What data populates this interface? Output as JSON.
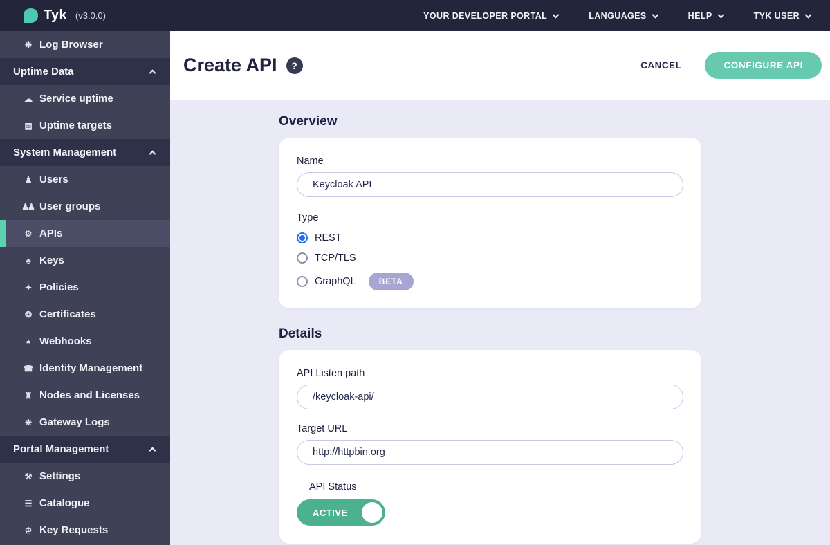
{
  "navbar": {
    "brand": "Tyk",
    "version": "(v3.0.0)",
    "menus": [
      {
        "label": "YOUR DEVELOPER PORTAL"
      },
      {
        "label": "LANGUAGES"
      },
      {
        "label": "HELP"
      },
      {
        "label": "TYK USER"
      }
    ]
  },
  "sidebar": {
    "items": [
      {
        "type": "item",
        "label": "Log Browser",
        "icon": "bug-icon",
        "glyph": "❉"
      },
      {
        "type": "section",
        "label": "Uptime Data",
        "icon": "chevron-up-icon"
      },
      {
        "type": "item",
        "label": "Service uptime",
        "icon": "cloud-icon",
        "glyph": "☁"
      },
      {
        "type": "item",
        "label": "Uptime targets",
        "icon": "grid-list-icon",
        "glyph": "▤"
      },
      {
        "type": "section",
        "label": "System Management",
        "icon": "chevron-up-icon"
      },
      {
        "type": "item",
        "label": "Users",
        "icon": "user-icon",
        "glyph": "♟"
      },
      {
        "type": "item",
        "label": "User groups",
        "icon": "user-group-icon",
        "glyph": "♟♟"
      },
      {
        "type": "item",
        "label": "APIs",
        "icon": "cogs-icon",
        "glyph": "⚙",
        "selected": true
      },
      {
        "type": "item",
        "label": "Keys",
        "icon": "sitemap-icon",
        "glyph": "♣"
      },
      {
        "type": "item",
        "label": "Policies",
        "icon": "policy-icon",
        "glyph": "✦"
      },
      {
        "type": "item",
        "label": "Certificates",
        "icon": "certificate-icon",
        "glyph": "❂"
      },
      {
        "type": "item",
        "label": "Webhooks",
        "icon": "bell-icon",
        "glyph": "♠"
      },
      {
        "type": "item",
        "label": "Identity Management",
        "icon": "phone-icon",
        "glyph": "☎"
      },
      {
        "type": "item",
        "label": "Nodes and Licenses",
        "icon": "bank-icon",
        "glyph": "♜"
      },
      {
        "type": "item",
        "label": "Gateway Logs",
        "icon": "bug-icon",
        "glyph": "❉"
      },
      {
        "type": "section",
        "label": "Portal Management",
        "icon": "chevron-up-icon"
      },
      {
        "type": "item",
        "label": "Settings",
        "icon": "wrench-icon",
        "glyph": "⚒"
      },
      {
        "type": "item",
        "label": "Catalogue",
        "icon": "list-icon",
        "glyph": "☰"
      },
      {
        "type": "item",
        "label": "Key Requests",
        "icon": "paw-icon",
        "glyph": "♔"
      }
    ]
  },
  "header": {
    "title": "Create API",
    "help_icon": "?",
    "cancel_label": "CANCEL",
    "configure_label": "CONFIGURE API"
  },
  "overview": {
    "heading": "Overview",
    "name_label": "Name",
    "name_value": "Keycloak API",
    "type_label": "Type",
    "radios": [
      {
        "label": "REST",
        "selected": true
      },
      {
        "label": "TCP/TLS",
        "selected": false
      },
      {
        "label": "GraphQL",
        "selected": false,
        "badge": "BETA"
      }
    ]
  },
  "details": {
    "heading": "Details",
    "listen_path_label": "API Listen path",
    "listen_path_value": "/keycloak-api/",
    "target_url_label": "Target URL",
    "target_url_value": "http://httpbin.org",
    "api_status_label": "API Status",
    "api_status_value": "ACTIVE"
  },
  "colors": {
    "accent_teal": "#5ED1AF",
    "button_teal": "#67CAAE",
    "toggle_green": "#4CB18E",
    "radio_blue": "#2A6AE9",
    "beta_badge": "#A7A5D2",
    "navbar_bg": "#23263B",
    "sidebar_item_bg": "#3F4257",
    "sidebar_section_bg": "#2E3147",
    "sidebar_selected_bg": "#4B4E66",
    "content_bg": "#E9EAF6",
    "heading_navy": "#1E2040"
  }
}
